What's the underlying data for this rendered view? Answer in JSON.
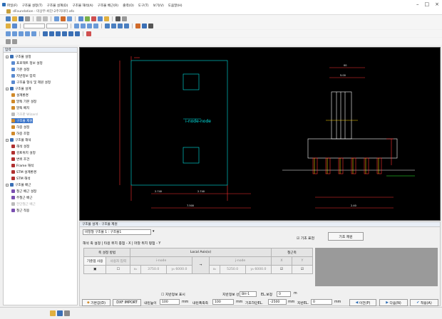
{
  "app": {
    "title": "dFoundation - 미상무-비단-2주지미터.afo",
    "menu": [
      "파일(F)",
      "구조물 설정(T)",
      "구조물 설계(D)",
      "구조물 해석(A)",
      "구조물 배근(R)",
      "출력(O)",
      "도구(T)",
      "보기(V)",
      "도움말(H)"
    ]
  },
  "left_panel": {
    "title": "입력",
    "tree": [
      {
        "label": "구조물 설정",
        "level": 0,
        "expander": "-",
        "icon_color": "#3a6fb5"
      },
      {
        "label": "프로젝트 정보 설정",
        "level": 1,
        "icon_color": "#5a8ad0"
      },
      {
        "label": "기본 설정",
        "level": 1,
        "icon_color": "#5a8ad0"
      },
      {
        "label": "지반정보 입력",
        "level": 1,
        "icon_color": "#5a8ad0"
      },
      {
        "label": "구조물 형식 및 제원 설정",
        "level": 1,
        "icon_color": "#5a8ad0"
      },
      {
        "label": "구조물 설계",
        "level": 0,
        "expander": "-",
        "icon_color": "#3a6fb5"
      },
      {
        "label": "설계환경",
        "level": 1,
        "icon_color": "#d08a2a"
      },
      {
        "label": "말뚝 기본 설정",
        "level": 1,
        "icon_color": "#d08a2a"
      },
      {
        "label": "말뚝 배치",
        "level": 1,
        "icon_color": "#d08a2a"
      },
      {
        "label": "기초판 Wizard",
        "level": 1,
        "icon_color": "#bbbbbb",
        "disabled": true
      },
      {
        "label": "구조물 제원",
        "level": 1,
        "icon_color": "#d08a2a",
        "selected": true
      },
      {
        "label": "하중 설정",
        "level": 1,
        "icon_color": "#d08a2a"
      },
      {
        "label": "하중 조합",
        "level": 1,
        "icon_color": "#d08a2a"
      },
      {
        "label": "구조물 해석",
        "level": 0,
        "expander": "-",
        "icon_color": "#3a6fb5"
      },
      {
        "label": "해석 설정",
        "level": 1,
        "icon_color": "#b03030"
      },
      {
        "label": "검토위치 설정",
        "level": 1,
        "icon_color": "#b03030"
      },
      {
        "label": "변위 조건",
        "level": 1,
        "icon_color": "#b03030"
      },
      {
        "label": "Frame 해석",
        "level": 1,
        "icon_color": "#b03030"
      },
      {
        "label": "STM 설계환경",
        "level": 1,
        "icon_color": "#b03030"
      },
      {
        "label": "STM 해석",
        "level": 1,
        "icon_color": "#b03030"
      },
      {
        "label": "구조물 배근",
        "level": 0,
        "expander": "-",
        "icon_color": "#3a6fb5"
      },
      {
        "label": "철근 배근 설정",
        "level": 1,
        "icon_color": "#7a4fb0"
      },
      {
        "label": "주철근 배근",
        "level": 1,
        "icon_color": "#7a4fb0"
      },
      {
        "label": "전단철근 배근",
        "level": 1,
        "icon_color": "#bbbbbb",
        "disabled": true
      },
      {
        "label": "철근 적용",
        "level": 1,
        "icon_color": "#7a4fb0"
      }
    ]
  },
  "drawing": {
    "plan_label": "i-node-node",
    "dims": [
      "2.740",
      "2.740",
      "7.500",
      "00",
      "5.00",
      "2.40"
    ]
  },
  "lower_panel": {
    "title": "구조물 설계 - 구조물 제원",
    "type_select": "비정형 구조물 1 : 구조물1",
    "tabs_text": "해석 축 설정  | 타원 위치 종점 - X  | 마찰 위치 평점 - Y",
    "checkbox_foundation": "기초 표현",
    "btn_foundation_view": "기초 제원",
    "grid": {
      "h_axis_method": "축 설정 방법",
      "h_local_axis": "Local Axis(x)",
      "h_rebar": "철근축",
      "h_sub1": "기준점 사용",
      "h_sub2": "사용자 입력",
      "h_inode": "i-node",
      "h_jnode": "j-node",
      "h_x": "X",
      "h_y": "Y",
      "row": {
        "xi_label": "x₀",
        "xi": "3750.0",
        "yi_label": "y₀",
        "yi": "6000.0",
        "xj_label": "x₀",
        "xj": "5250.0",
        "yj_label": "y₀",
        "yj": "6000.0",
        "arrow": "→"
      }
    },
    "bottom_row1": {
      "chk_ground": "지반정보 표시",
      "ground_sel_label": "지반정보 선택",
      "ground_sel_value": "BH-1",
      "el_label": "EL.보정",
      "el_value": "0",
      "el_unit": "m"
    },
    "bottom_row2": {
      "btn_default": "기본값(D)",
      "btn_dxf": "DXF IMPORT",
      "depth_label": "내린높이",
      "depth_value": "100",
      "unit1": "mm",
      "cover_label": "내린폭축측",
      "cover_value": "100",
      "unit2": "mm",
      "base_el_label": "기초하단EL.",
      "base_el_value": "-2500",
      "unit3": "mm",
      "ground_el_label": "지반EL.",
      "ground_el_value": "0",
      "unit4": "mm",
      "btn_prev": "이전(P)",
      "btn_next": "다음(N)",
      "btn_apply": "적용(A)"
    }
  },
  "colors": {
    "canvas_bg": "#000000",
    "line_red": "#ff3030",
    "line_cyan": "#00e5e5",
    "line_white": "#ffffff",
    "line_yellow": "#ffd400",
    "line_green": "#30ff30"
  }
}
